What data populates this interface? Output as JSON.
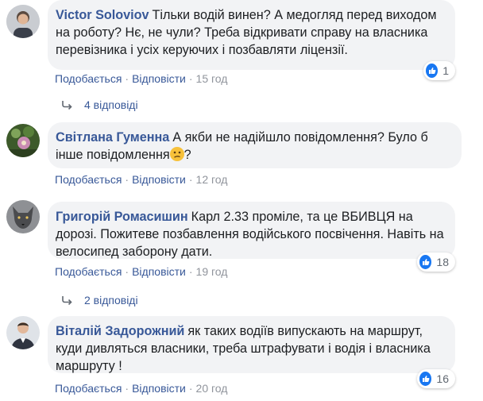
{
  "comments": [
    {
      "author": "Victor Soloviov",
      "text": "Тільки водій винен? А медогляд перед виходом на роботу? Нє, не чули? Треба відкривати справу на власника перевізника і усіх керуючих і позбавляти ліцензії.",
      "like": "Подобається",
      "reply": "Відповісти",
      "time": "15 год",
      "reactions": "1",
      "avatar": "male-portrait-avatar"
    },
    {
      "author": "Світлана Гуменна",
      "text": "А якби не надійшло повідомлення? Було б інше повідомлення",
      "text_tail": "?",
      "emoji": "confused-face-emoji",
      "like": "Подобається",
      "reply": "Відповісти",
      "time": "12 год",
      "avatar": "flower-photo-avatar"
    },
    {
      "author": "Григорій Ромасишин",
      "text": "Карл 2.33 проміле, та це ВБИВЦЯ на дорозі. Пожитеве позбавлення водійського посвічення. Навіть на велосипед заборону дати.",
      "like": "Подобається",
      "reply": "Відповісти",
      "time": "19 год",
      "reactions": "18",
      "avatar": "wolf-photo-avatar"
    },
    {
      "author": "Віталій Задорожний",
      "text": "як таких водіїв випускають на маршрут, куди дивляться власники, треба штрафувати і водія і власника маршруту !",
      "like": "Подобається",
      "reply": "Відповісти",
      "time": "20 год",
      "reactions": "16",
      "avatar": "man-suit-avatar"
    }
  ],
  "reply_threads": [
    {
      "label": "4 відповіді"
    },
    {
      "label": "2 відповіді"
    }
  ],
  "colors": {
    "link": "#385898",
    "meta": "#90949c",
    "bubble": "#f2f3f5",
    "like": "#1877f2"
  },
  "separator": "·"
}
